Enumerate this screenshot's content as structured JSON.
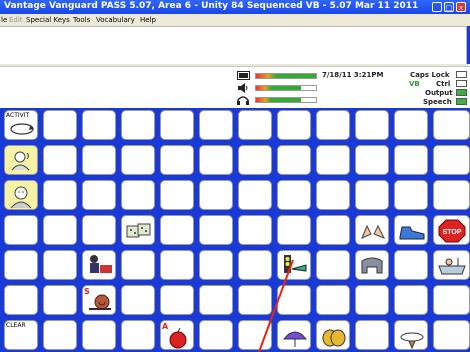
{
  "window": {
    "title": "Vantage Vanguard PASS 5.07, Area 6 - Unity 84 Sequenced VB - 5.07 Mar 11 2011"
  },
  "menu": [
    "le",
    "Edit",
    "Special Keys",
    "Tools",
    "Vocabulary",
    "Help"
  ],
  "status": {
    "datetime": "7/18/11 3:21PM",
    "caps_lock": "Caps Lock",
    "vb": "VB",
    "ctrl": "Ctrl",
    "output": "Output",
    "speech": "Speech",
    "speaker_volume": 0.75,
    "headset_volume": 0.75
  },
  "keys": {
    "activities": "ACTIVIT",
    "clear": "CLEAR",
    "stop": "STOP",
    "apple_letter": "A",
    "snail_letter": "S"
  },
  "colors": {
    "accent": "#1a3ad8",
    "highlight_key": "#f7f3a6",
    "indicator_on": "#3cb043"
  }
}
